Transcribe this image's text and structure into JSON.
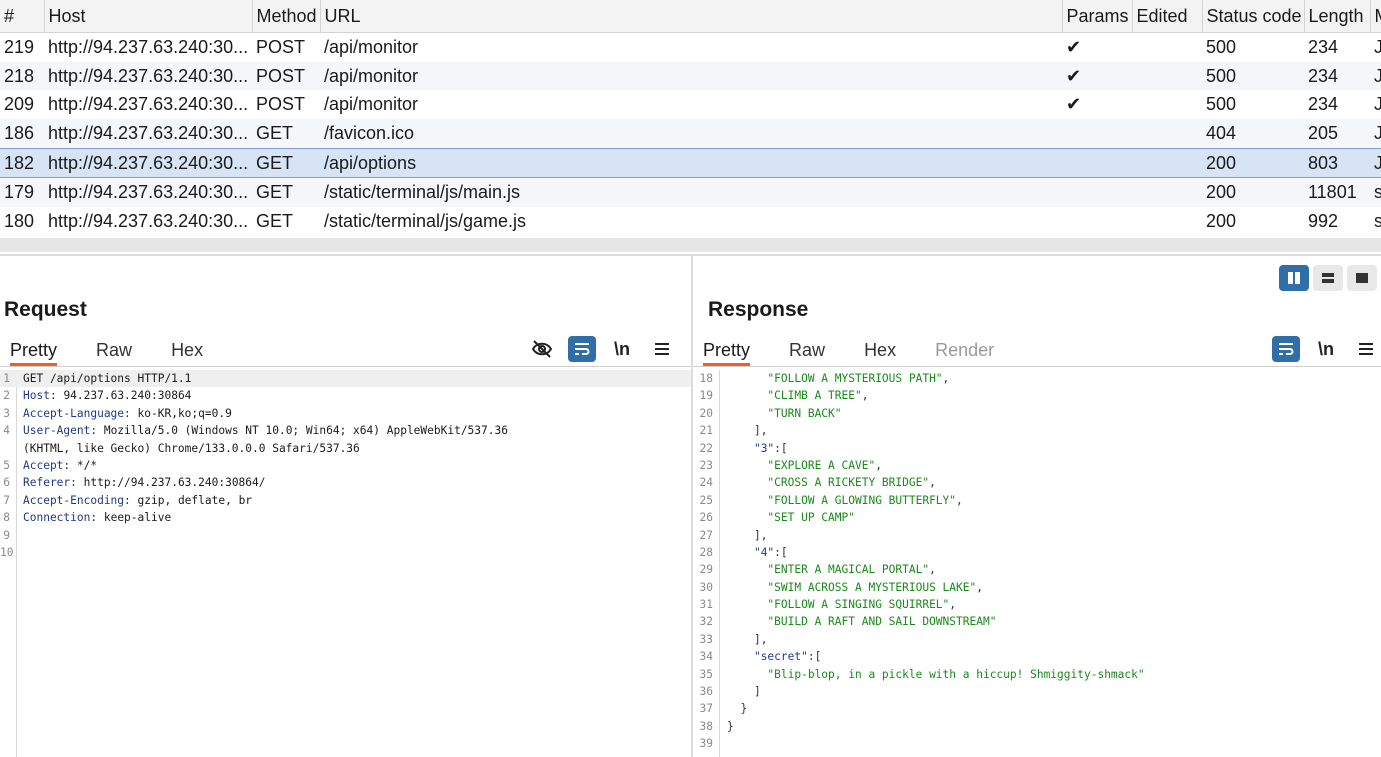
{
  "history": {
    "columns": [
      "#",
      "Host",
      "Method",
      "URL",
      "Params",
      "Edited",
      "Status code",
      "Length",
      "M"
    ],
    "rows": [
      {
        "num": "219",
        "host": "http://94.237.63.240:30...",
        "method": "POST",
        "url": "/api/monitor",
        "params": "✔",
        "edited": "",
        "status": "500",
        "length": "234",
        "mime": "J"
      },
      {
        "num": "218",
        "host": "http://94.237.63.240:30...",
        "method": "POST",
        "url": "/api/monitor",
        "params": "✔",
        "edited": "",
        "status": "500",
        "length": "234",
        "mime": "J"
      },
      {
        "num": "209",
        "host": "http://94.237.63.240:30...",
        "method": "POST",
        "url": "/api/monitor",
        "params": "✔",
        "edited": "",
        "status": "500",
        "length": "234",
        "mime": "J"
      },
      {
        "num": "186",
        "host": "http://94.237.63.240:30...",
        "method": "GET",
        "url": "/favicon.ico",
        "params": "",
        "edited": "",
        "status": "404",
        "length": "205",
        "mime": "J"
      },
      {
        "num": "182",
        "host": "http://94.237.63.240:30...",
        "method": "GET",
        "url": "/api/options",
        "params": "",
        "edited": "",
        "status": "200",
        "length": "803",
        "mime": "J"
      },
      {
        "num": "179",
        "host": "http://94.237.63.240:30...",
        "method": "GET",
        "url": "/static/terminal/js/main.js",
        "params": "",
        "edited": "",
        "status": "200",
        "length": "11801",
        "mime": "s"
      },
      {
        "num": "180",
        "host": "http://94.237.63.240:30...",
        "method": "GET",
        "url": "/static/terminal/js/game.js",
        "params": "",
        "edited": "",
        "status": "200",
        "length": "992",
        "mime": "s"
      }
    ],
    "selected_num": "182"
  },
  "request": {
    "title": "Request",
    "tabs": [
      "Pretty",
      "Raw",
      "Hex"
    ],
    "active_tab": "Pretty",
    "newline_label": "\\n",
    "lines": [
      {
        "n": "1",
        "name": "",
        "value": "GET /api/options HTTP/1.1"
      },
      {
        "n": "2",
        "name": "Host",
        "value": " 94.237.63.240:30864"
      },
      {
        "n": "3",
        "name": "Accept-Language",
        "value": " ko-KR,ko;q=0.9"
      },
      {
        "n": "4",
        "name": "User-Agent",
        "value": " Mozilla/5.0 (Windows NT 10.0; Win64; x64) AppleWebKit/537.36"
      },
      {
        "n": "",
        "name": "",
        "value": "(KHTML, like Gecko) Chrome/133.0.0.0 Safari/537.36"
      },
      {
        "n": "5",
        "name": "Accept",
        "value": " */*"
      },
      {
        "n": "6",
        "name": "Referer",
        "value": " http://94.237.63.240:30864/"
      },
      {
        "n": "7",
        "name": "Accept-Encoding",
        "value": " gzip, deflate, br"
      },
      {
        "n": "8",
        "name": "Connection",
        "value": " keep-alive"
      },
      {
        "n": "9",
        "name": "",
        "value": ""
      },
      {
        "n": "10",
        "name": "",
        "value": ""
      }
    ]
  },
  "response": {
    "title": "Response",
    "tabs": [
      "Pretty",
      "Raw",
      "Hex",
      "Render"
    ],
    "active_tab": "Pretty",
    "newline_label": "\\n",
    "lines": [
      {
        "n": "18",
        "indent": "      ",
        "key": "",
        "str": "\"FOLLOW A MYSTERIOUS PATH\"",
        "after": ","
      },
      {
        "n": "19",
        "indent": "      ",
        "key": "",
        "str": "\"CLIMB A TREE\"",
        "after": ","
      },
      {
        "n": "20",
        "indent": "      ",
        "key": "",
        "str": "\"TURN BACK\"",
        "after": ""
      },
      {
        "n": "21",
        "indent": "    ",
        "key": "",
        "str": "",
        "after": "],"
      },
      {
        "n": "22",
        "indent": "    ",
        "key": "\"3\"",
        "str": "",
        "after": ":["
      },
      {
        "n": "23",
        "indent": "      ",
        "key": "",
        "str": "\"EXPLORE A CAVE\"",
        "after": ","
      },
      {
        "n": "24",
        "indent": "      ",
        "key": "",
        "str": "\"CROSS A RICKETY BRIDGE\"",
        "after": ","
      },
      {
        "n": "25",
        "indent": "      ",
        "key": "",
        "str": "\"FOLLOW A GLOWING BUTTERFLY\"",
        "after": ","
      },
      {
        "n": "26",
        "indent": "      ",
        "key": "",
        "str": "\"SET UP CAMP\"",
        "after": ""
      },
      {
        "n": "27",
        "indent": "    ",
        "key": "",
        "str": "",
        "after": "],"
      },
      {
        "n": "28",
        "indent": "    ",
        "key": "\"4\"",
        "str": "",
        "after": ":["
      },
      {
        "n": "29",
        "indent": "      ",
        "key": "",
        "str": "\"ENTER A MAGICAL PORTAL\"",
        "after": ","
      },
      {
        "n": "30",
        "indent": "      ",
        "key": "",
        "str": "\"SWIM ACROSS A MYSTERIOUS LAKE\"",
        "after": ","
      },
      {
        "n": "31",
        "indent": "      ",
        "key": "",
        "str": "\"FOLLOW A SINGING SQUIRREL\"",
        "after": ","
      },
      {
        "n": "32",
        "indent": "      ",
        "key": "",
        "str": "\"BUILD A RAFT AND SAIL DOWNSTREAM\"",
        "after": ""
      },
      {
        "n": "33",
        "indent": "    ",
        "key": "",
        "str": "",
        "after": "],"
      },
      {
        "n": "34",
        "indent": "    ",
        "key": "\"secret\"",
        "str": "",
        "after": ":["
      },
      {
        "n": "35",
        "indent": "      ",
        "key": "",
        "str": "\"Blip-blop, in a pickle with a hiccup! Shmiggity-shmack\"",
        "after": ""
      },
      {
        "n": "36",
        "indent": "    ",
        "key": "",
        "str": "",
        "after": "]"
      },
      {
        "n": "37",
        "indent": "  ",
        "key": "",
        "str": "",
        "after": "}"
      },
      {
        "n": "38",
        "indent": "",
        "key": "",
        "str": "",
        "after": "}"
      },
      {
        "n": "39",
        "indent": "",
        "key": "",
        "str": "",
        "after": ""
      }
    ]
  },
  "icons": {
    "hide": "eye-slash-icon",
    "wrap": "wrap-lines-icon",
    "menu": "hamburger-menu-icon",
    "layout_split": "layout-split-icon",
    "layout_stack": "layout-stack-icon",
    "layout_single": "layout-single-icon"
  },
  "colors": {
    "accent_blue": "#2f6ea9",
    "tab_underline": "#e8602c",
    "selected_row": "#d6e4f5",
    "string_green": "#1a8a1a",
    "header_blue": "#1f3a8a"
  }
}
